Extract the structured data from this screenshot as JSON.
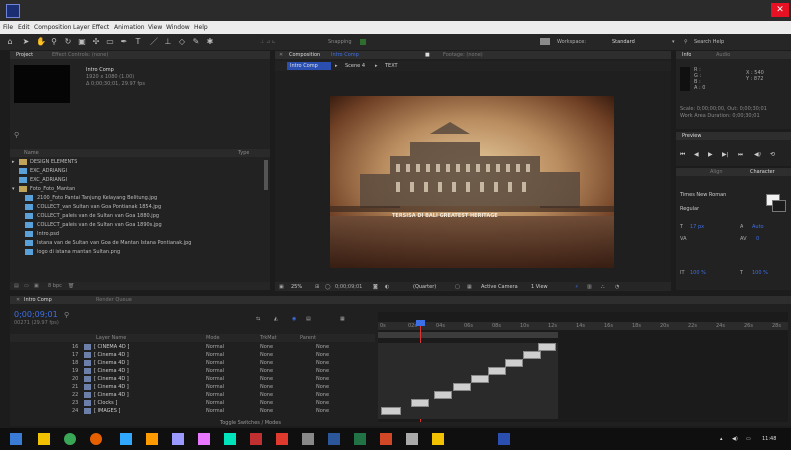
{
  "window": {
    "close_glyph": "✕"
  },
  "menubar": [
    "File",
    "Edit",
    "Composition",
    "Layer",
    "Effect",
    "Animation",
    "View",
    "Window",
    "Help"
  ],
  "toolbar": {
    "icons": [
      "home-icon",
      "select-icon",
      "hand-icon",
      "zoom-icon",
      "rotate-icon",
      "camera-icon",
      "pan-behind-icon",
      "mask-icon",
      "pen-icon",
      "text-icon",
      "brush-icon",
      "clone-icon",
      "eraser-icon",
      "roto-icon",
      "puppet-icon"
    ],
    "workspace_label": "Workspace:",
    "workspace_value": "Standard",
    "search_placeholder": "Search Help",
    "snapping_label": "Snapping"
  },
  "project": {
    "tab": "Project",
    "effect_controls": "Effect Controls: (none)",
    "comp_name": "Intro Comp",
    "comp_info": "1920 x 1080 (1.00)",
    "comp_duration": "Δ 0;00;30;01, 29.97 fps",
    "search_icon": "search-icon",
    "col_name": "Name",
    "col_type": "Type",
    "col_size": "Size",
    "items": [
      {
        "name": "DESIGN ELEMENTS",
        "type": "folder"
      },
      {
        "name": "EXC_ADRIANGI",
        "type": "folder"
      },
      {
        "name": "EXC_ADRIANGI",
        "type": "folder"
      },
      {
        "name": "Foto_Foto_Mantan",
        "type": "folder"
      },
      {
        "name": "2100_Foto Pantai Tanjung Kelayang Belitung.jpg",
        "type": "image"
      },
      {
        "name": "COLLECT_van Sultan van Goa Pontianak 1854.jpg",
        "type": "image"
      },
      {
        "name": "COLLECT_paleis van de Sultan van Goa 1880.jpg",
        "type": "image"
      },
      {
        "name": "COLLECT_paleis van de Sultan van Goa 1890s.jpg",
        "type": "image"
      },
      {
        "name": "Intro.psd",
        "type": "image"
      },
      {
        "name": "Istana van de Sultan van Goa de Mantan Istana Pontianak.jpg",
        "type": "image"
      },
      {
        "name": "logo di istana mantan Sultan.png",
        "type": "image"
      }
    ],
    "bpc": "8 bpc"
  },
  "composition": {
    "tab_label": "Composition",
    "comp_name": "Intro Comp",
    "footage_label": "Footage: (none)",
    "crumb_1": "Intro Comp",
    "crumb_2": "Scene 4",
    "crumb_3": "TEXT",
    "overlay_text": "TERSISA DI BALI GREATEST HERITAGE",
    "zoom": "25%",
    "timecode": "0;00;09;01",
    "resolution": "(Quarter)",
    "camera": "Active Camera",
    "views": "1 View"
  },
  "info": {
    "tab": "Info",
    "audio_tab": "Audio",
    "r": "R :",
    "g": "G :",
    "b": "B :",
    "a": "A : 0",
    "x": "X : 540",
    "y": "Y : 872",
    "line1": "Scale: 0;00;00;00, Out: 0;00;30;01",
    "line2": "Work Area Duration: 0;00;30;01"
  },
  "preview": {
    "tab": "Preview"
  },
  "character": {
    "tab": "Character",
    "tab2": "Align",
    "font": "Times New Roman",
    "style": "Regular",
    "size": "17 px",
    "leading": "Auto",
    "tracking": "0",
    "v_scale": "100 %",
    "h_scale": "100 %"
  },
  "timeline": {
    "tab": "Intro Comp",
    "tab2": "Render Queue",
    "timecode": "0;00;09;01",
    "timecode_sub": "00271 (29.97 fps)",
    "col_layer": "Layer Name",
    "col_mode": "Mode",
    "col_trkmat": "TrkMat",
    "col_parent": "Parent",
    "toggle_label": "Toggle Switches / Modes",
    "ruler": [
      "0s",
      "02s",
      "04s",
      "06s",
      "08s",
      "10s",
      "12s",
      "14s",
      "16s",
      "18s",
      "20s",
      "22s",
      "24s",
      "26s",
      "28s"
    ],
    "layers": [
      {
        "num": "16",
        "name": "[ CINEMA 4D ]",
        "mode": "Normal",
        "trkmat": "None",
        "parent": "None"
      },
      {
        "num": "17",
        "name": "[ Cinema 4D ]",
        "mode": "Normal",
        "trkmat": "None",
        "parent": "None"
      },
      {
        "num": "18",
        "name": "[ Cinema 4D ]",
        "mode": "Normal",
        "trkmat": "None",
        "parent": "None"
      },
      {
        "num": "19",
        "name": "[ Cinema 4D ]",
        "mode": "Normal",
        "trkmat": "None",
        "parent": "None"
      },
      {
        "num": "20",
        "name": "[ Cinema 4D ]",
        "mode": "Normal",
        "trkmat": "None",
        "parent": "None"
      },
      {
        "num": "21",
        "name": "[ Cinema 4D ]",
        "mode": "Normal",
        "trkmat": "None",
        "parent": "None"
      },
      {
        "num": "22",
        "name": "[ Cinema 4D ]",
        "mode": "Normal",
        "trkmat": "None",
        "parent": "None"
      },
      {
        "num": "23",
        "name": "[ Clocks ]",
        "mode": "Normal",
        "trkmat": "None",
        "parent": "None"
      },
      {
        "num": "24",
        "name": "[ IMAGES ]",
        "mode": "Normal",
        "trkmat": "None",
        "parent": "None"
      }
    ]
  },
  "taskbar": {
    "icons": [
      "windows-icon",
      "explorer-icon",
      "chrome-icon",
      "firefox-icon",
      "photoshop-icon",
      "illustrator-icon",
      "aftereffects-icon",
      "premiere-icon",
      "audition-icon",
      "mail-icon",
      "media-icon",
      "paint-icon",
      "word-icon",
      "excel-icon",
      "powerpoint-icon",
      "settings-icon",
      "folder-icon",
      "cinema4d-icon",
      "network-icon",
      "volume-icon",
      "battery-icon"
    ],
    "clock": "11:48"
  }
}
